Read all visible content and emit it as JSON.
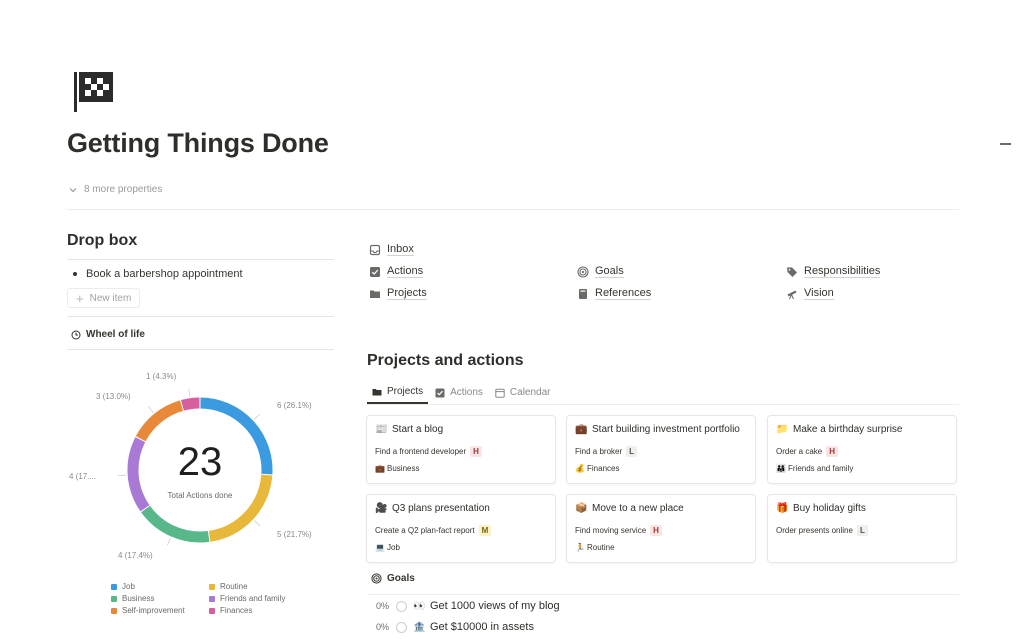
{
  "page": {
    "title": "Getting Things Done",
    "more_properties": "8 more properties"
  },
  "dropbox": {
    "title": "Drop box",
    "items": [
      "Book a barbershop appointment"
    ],
    "new_item": "New item"
  },
  "wheel": {
    "label": "Wheel of life",
    "total": "23",
    "total_label": "Total Actions done",
    "slice_labels": [
      "6 (26.1%)",
      "5 (21.7%)",
      "4 (17.4%)",
      "4 (17....",
      "3 (13.0%)",
      "1 (4.3%)"
    ],
    "legend": [
      {
        "label": "Job",
        "color": "#3b9be0"
      },
      {
        "label": "Routine",
        "color": "#e8b83a"
      },
      {
        "label": "Business",
        "color": "#58b88a"
      },
      {
        "label": "Friends and family",
        "color": "#a87ad6"
      },
      {
        "label": "Self-improvement",
        "color": "#e8893a"
      },
      {
        "label": "Finances",
        "color": "#d85f9e"
      }
    ]
  },
  "chart_data": {
    "type": "pie",
    "title": "",
    "categories": [
      "Job",
      "Routine",
      "Business",
      "Friends and family",
      "Self-improvement",
      "Finances"
    ],
    "values": [
      6,
      5,
      4,
      4,
      3,
      1
    ],
    "colors": [
      "#3b9be0",
      "#e8b83a",
      "#58b88a",
      "#a87ad6",
      "#e8893a",
      "#d85f9e"
    ]
  },
  "links": [
    {
      "label": "Inbox",
      "icon": "inbox-icon"
    },
    {
      "label": "Actions",
      "icon": "checkbox-icon"
    },
    {
      "label": "Goals",
      "icon": "target-icon"
    },
    {
      "label": "Responsibilities",
      "icon": "tag-icon"
    },
    {
      "label": "Projects",
      "icon": "folder-icon"
    },
    {
      "label": "References",
      "icon": "book-icon"
    },
    {
      "label": "Vision",
      "icon": "telescope-icon"
    }
  ],
  "projects": {
    "title": "Projects and actions",
    "tabs": [
      "Projects",
      "Actions",
      "Calendar"
    ],
    "cards": [
      {
        "icon": "📰",
        "title": "Start a blog",
        "sub": "Find a frontend developer",
        "priority": "H",
        "cat_icon": "💼",
        "cat": "Business"
      },
      {
        "icon": "💼",
        "title": "Start building investment portfolio",
        "sub": "Find a broker",
        "priority": "L",
        "cat_icon": "💰",
        "cat": "Finances"
      },
      {
        "icon": "📁",
        "title": "Make a birthday surprise",
        "sub": "Order a cake",
        "priority": "H",
        "cat_icon": "👨‍👩‍👧",
        "cat": "Friends and family"
      },
      {
        "icon": "🎥",
        "title": "Q3 plans presentation",
        "sub": "Create a Q2 plan-fact report",
        "priority": "M",
        "cat_icon": "💻",
        "cat": "Job"
      },
      {
        "icon": "📦",
        "title": "Move to a new place",
        "sub": "Find moving service",
        "priority": "H",
        "cat_icon": "🏃",
        "cat": "Routine"
      },
      {
        "icon": "🎁",
        "title": "Buy holiday gifts",
        "sub": "Order presents online",
        "priority": "L",
        "cat_icon": "",
        "cat": ""
      }
    ]
  },
  "goals": {
    "label": "Goals",
    "items": [
      {
        "pct": "0%",
        "emoji": "👀",
        "name": "Get 1000 views of my blog"
      },
      {
        "pct": "0%",
        "emoji": "🏦",
        "name": "Get $10000 in assets"
      }
    ]
  }
}
